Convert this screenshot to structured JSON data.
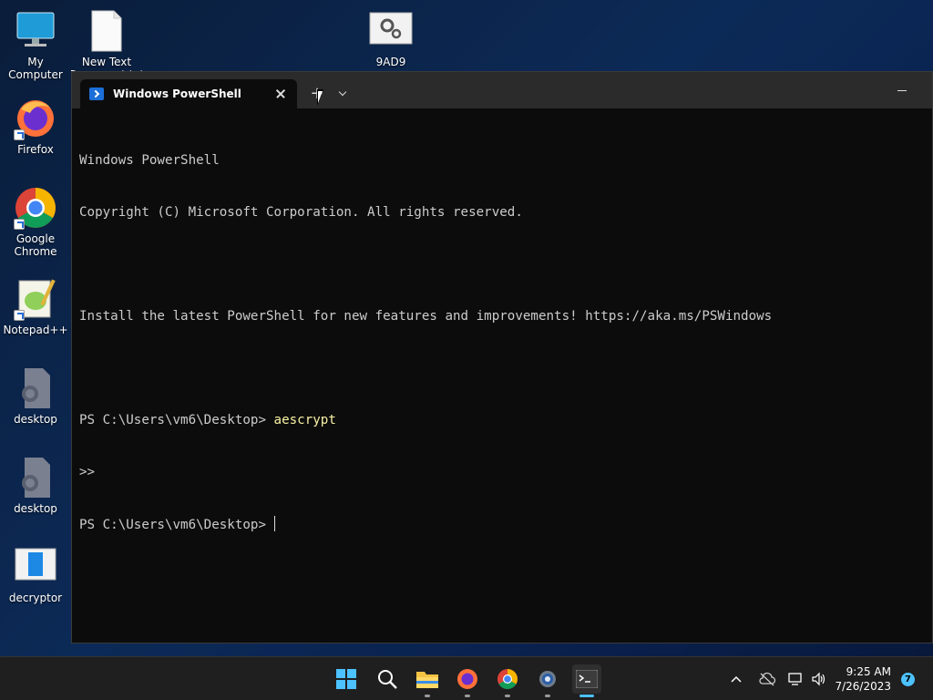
{
  "desktop": {
    "icons": [
      {
        "label": "My Computer",
        "icon": "monitor-icon"
      },
      {
        "label": "New Text\nDocument.txt",
        "icon": "text-document-icon"
      },
      {
        "label": "9AD9",
        "icon": "settings-file-icon"
      },
      {
        "label": "Firefox",
        "icon": "firefox-icon"
      },
      {
        "label": "Google\nChrome",
        "icon": "chrome-icon"
      },
      {
        "label": "Notepad++",
        "icon": "notepadpp-icon"
      },
      {
        "label": "desktop",
        "icon": "settings-file-icon"
      },
      {
        "label": "desktop",
        "icon": "settings-file-icon"
      },
      {
        "label": "decryptor",
        "icon": "app-window-icon"
      }
    ]
  },
  "terminal": {
    "tab_title": "Windows PowerShell",
    "new_tab_glyph": "+",
    "lines": [
      {
        "text": "Windows PowerShell"
      },
      {
        "text": "Copyright (C) Microsoft Corporation. All rights reserved."
      },
      {
        "text": ""
      },
      {
        "text": "Install the latest PowerShell for new features and improvements! https://aka.ms/PSWindows"
      },
      {
        "text": ""
      },
      {
        "prompt": "PS C:\\Users\\vm6\\Desktop> ",
        "command": "aescrypt"
      },
      {
        "text": ">>"
      },
      {
        "prompt": "PS C:\\Users\\vm6\\Desktop> ",
        "command": "",
        "cursor": true
      }
    ]
  },
  "taskbar": {
    "apps": [
      {
        "name": "start-icon"
      },
      {
        "name": "search-icon"
      },
      {
        "name": "file-explorer-icon"
      },
      {
        "name": "firefox-icon"
      },
      {
        "name": "chrome-icon"
      },
      {
        "name": "settings-icon"
      },
      {
        "name": "terminal-icon",
        "active": true
      }
    ],
    "clock_time": "9:25 AM",
    "clock_date": "7/26/2023",
    "notification_count": "7"
  }
}
